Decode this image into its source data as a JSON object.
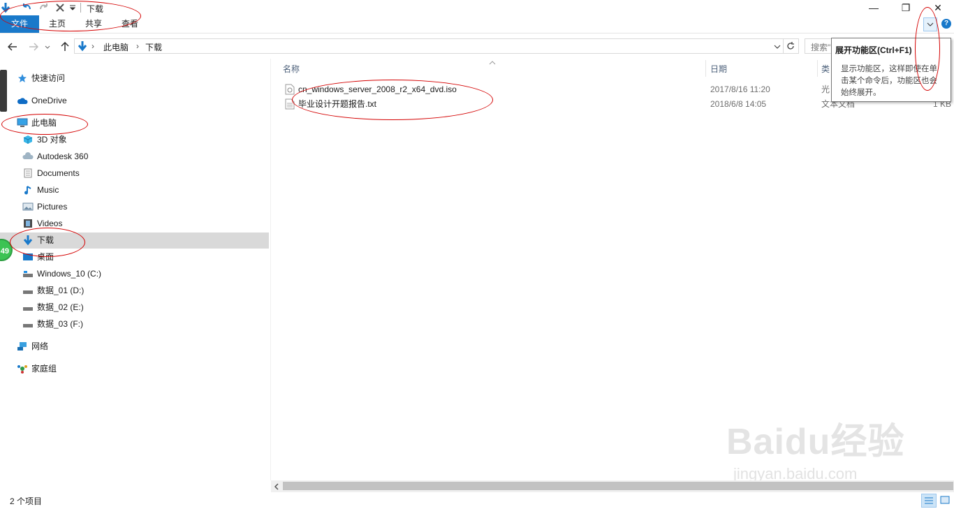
{
  "window": {
    "title": "下载",
    "controls": {
      "minimize": "—",
      "restore": "❐",
      "close": "✕"
    }
  },
  "ribbon": {
    "tabs": [
      "文件",
      "主页",
      "共享",
      "查看"
    ]
  },
  "address": {
    "crumbs": [
      "此电脑",
      "下载"
    ],
    "search_placeholder": "搜索\"下载\""
  },
  "tooltip": {
    "title": "展开功能区(Ctrl+F1)",
    "body_lines": [
      "显示功能区，这样即使在单",
      "击某个命令后，功能区也会",
      "始终展开。"
    ]
  },
  "sidebar": {
    "items": [
      {
        "label": "快速访问",
        "icon": "star-icon"
      },
      {
        "label": "OneDrive",
        "icon": "cloud-icon"
      },
      {
        "label": "此电脑",
        "icon": "computer-icon"
      },
      {
        "label": "3D 对象",
        "icon": "cube-icon"
      },
      {
        "label": "Autodesk 360",
        "icon": "cloud-drive-icon"
      },
      {
        "label": "Documents",
        "icon": "document-icon"
      },
      {
        "label": "Music",
        "icon": "music-icon"
      },
      {
        "label": "Pictures",
        "icon": "picture-icon"
      },
      {
        "label": "Videos",
        "icon": "video-icon"
      },
      {
        "label": "下载",
        "icon": "download-icon"
      },
      {
        "label": "桌面",
        "icon": "desktop-icon"
      },
      {
        "label": "Windows_10 (C:)",
        "icon": "drive-icon"
      },
      {
        "label": "数据_01 (D:)",
        "icon": "drive-icon"
      },
      {
        "label": "数据_02 (E:)",
        "icon": "drive-icon"
      },
      {
        "label": "数据_03 (F:)",
        "icon": "drive-icon"
      },
      {
        "label": "网络",
        "icon": "network-icon"
      },
      {
        "label": "家庭组",
        "icon": "homegroup-icon"
      }
    ]
  },
  "columns": [
    "名称",
    "日期",
    "类"
  ],
  "files": [
    {
      "name": "cn_windows_server_2008_r2_x64_dvd.iso",
      "date": "2017/8/16 11:20",
      "type": "光",
      "size": ""
    },
    {
      "name": "毕业设计开题报告.txt",
      "date": "2018/6/8 14:05",
      "type": "文本文档",
      "size": "1 KB"
    }
  ],
  "status": {
    "count": "2 个项目"
  },
  "badge": {
    "value": "49"
  },
  "watermark": {
    "brand": "Baidu经验",
    "url": "jingyan.baidu.com"
  },
  "colors": {
    "accent": "#1979ca",
    "annotation": "#d40000",
    "selection": "#d9d9d9"
  }
}
